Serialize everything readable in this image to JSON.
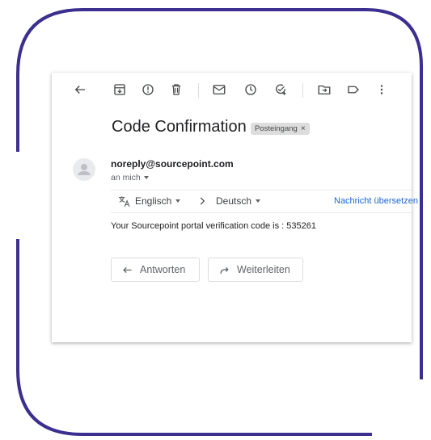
{
  "toolbar": {
    "icons": [
      "back-arrow-icon",
      "archive-icon",
      "report-spam-icon",
      "delete-icon",
      "mark-unread-icon",
      "snooze-icon",
      "add-task-icon",
      "move-to-icon",
      "labels-icon",
      "more-options-icon"
    ]
  },
  "email": {
    "subject": "Code Confirmation",
    "label": "Posteingang",
    "label_remove": "×",
    "sender": "noreply@sourcepoint.com",
    "recipient": "an mich",
    "body": "Your Sourcepoint portal verification code is : 535261"
  },
  "translate": {
    "from_language": "Englisch",
    "to_language": "Deutsch",
    "translate_link": "Nachricht übersetzen"
  },
  "actions": {
    "reply_label": "Antworten",
    "forward_label": "Weiterleiten"
  },
  "colors": {
    "frame": "#3b2f8f",
    "link": "#1a66d2",
    "text": "#202124",
    "muted": "#5f6368"
  }
}
